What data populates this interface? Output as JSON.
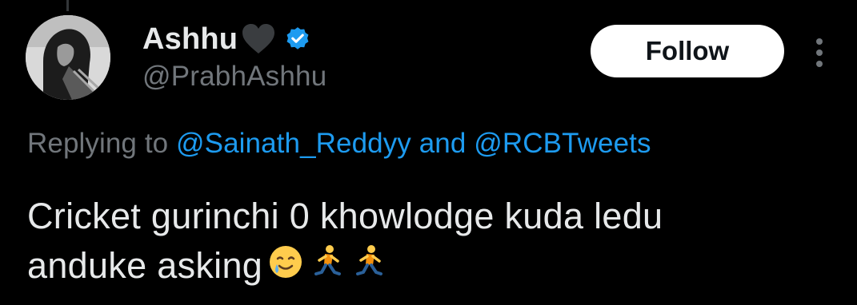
{
  "author": {
    "display_name": "Ashhu",
    "handle": "@PrabhAshhu",
    "verified": true,
    "verified_color": "#1d9bf0",
    "name_emoji": "black-heart-icon"
  },
  "actions": {
    "follow_label": "Follow",
    "more_icon": "more-vertical-icon"
  },
  "reply": {
    "prefix": "Replying to",
    "mention_1": "@Sainath_Reddyy",
    "joiner": "and",
    "mention_2": "@RCBTweets"
  },
  "tweet": {
    "line_1": "Cricket gurinchi 0 khowlodge kuda ledu",
    "line_2": "anduke asking",
    "emojis": [
      "smiling-face-with-tear-icon",
      "person-running-icon",
      "person-running-icon"
    ]
  },
  "colors": {
    "background": "#000000",
    "text_primary": "#e7e9ea",
    "text_secondary": "#71767b",
    "link": "#1d9bf0",
    "follow_bg": "#ffffff"
  }
}
